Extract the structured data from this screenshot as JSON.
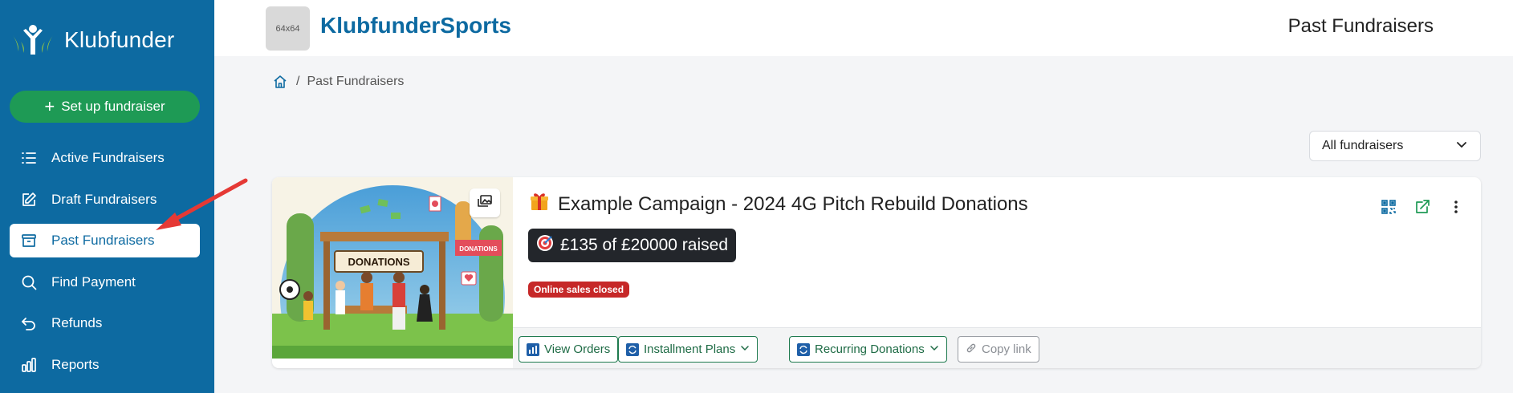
{
  "sidebar": {
    "brand": "Klubfunder",
    "setup_button": "Set up fundraiser",
    "items": [
      {
        "label": "Active Fundraisers",
        "icon": "list-icon"
      },
      {
        "label": "Draft Fundraisers",
        "icon": "edit-icon"
      },
      {
        "label": "Past Fundraisers",
        "icon": "archive-icon",
        "active": true
      },
      {
        "label": "Find Payment",
        "icon": "search-icon"
      },
      {
        "label": "Refunds",
        "icon": "undo-icon"
      },
      {
        "label": "Reports",
        "icon": "bar-chart-icon"
      }
    ]
  },
  "header": {
    "logo_placeholder": "64x64",
    "org_name": "KlubfunderSports",
    "page_title": "Past Fundraisers"
  },
  "breadcrumb": {
    "current": "Past Fundraisers"
  },
  "filter": {
    "selected": "All fundraisers"
  },
  "campaign": {
    "title": "Example Campaign - 2024 4G Pitch Rebuild Donations",
    "raised_text": "£135 of £20000 raised",
    "status_badge": "Online sales closed",
    "image_sign": "DONATIONS",
    "image_banner": "DONATIONS",
    "buttons": {
      "view_orders": "View Orders",
      "installment_plans": "Installment Plans",
      "recurring_donations": "Recurring Donations",
      "copy_link": "Copy link"
    }
  },
  "colors": {
    "sidebar": "#0d6aa1",
    "setup_button": "#1e9a55",
    "status_badge": "#c62828",
    "raised_badge": "#23262b"
  }
}
